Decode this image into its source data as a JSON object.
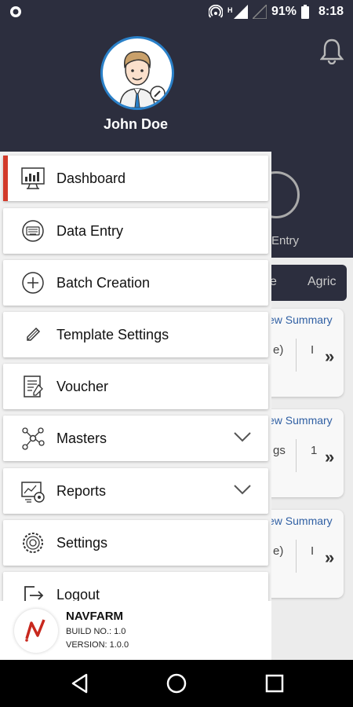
{
  "status_bar": {
    "battery": "91%",
    "time": "8:18"
  },
  "drawer": {
    "user_name": "John Doe",
    "menu": [
      {
        "label": "Dashboard",
        "icon": "dashboard-icon",
        "active": true
      },
      {
        "label": "Data Entry",
        "icon": "data-entry-icon"
      },
      {
        "label": "Batch Creation",
        "icon": "batch-creation-icon"
      },
      {
        "label": "Template Settings",
        "icon": "template-settings-icon"
      },
      {
        "label": "Voucher",
        "icon": "voucher-icon"
      },
      {
        "label": "Masters",
        "icon": "masters-icon",
        "expandable": true
      },
      {
        "label": "Reports",
        "icon": "reports-icon",
        "expandable": true
      },
      {
        "label": "Settings",
        "icon": "settings-icon"
      },
      {
        "label": "Logout",
        "icon": "logout-icon"
      }
    ],
    "footer": {
      "brand": "NAVFARM",
      "build": "BUILD NO.: 1.0",
      "version": "VERSION: 1.0.0"
    }
  },
  "background": {
    "entry_label": "Entry",
    "tabs": [
      "e",
      "Agric"
    ],
    "cards": [
      {
        "link": "ew Summary",
        "frag1": "e)",
        "frag2": "I"
      },
      {
        "link": "ew Summary",
        "frag1": "gs",
        "frag2": "1"
      },
      {
        "link": "ew Summary",
        "frag1": "e)",
        "frag2": "I"
      }
    ]
  },
  "colors": {
    "header": "#2c2e3e",
    "active_indicator": "#d23a2a",
    "avatar_ring": "#2a80c8"
  }
}
